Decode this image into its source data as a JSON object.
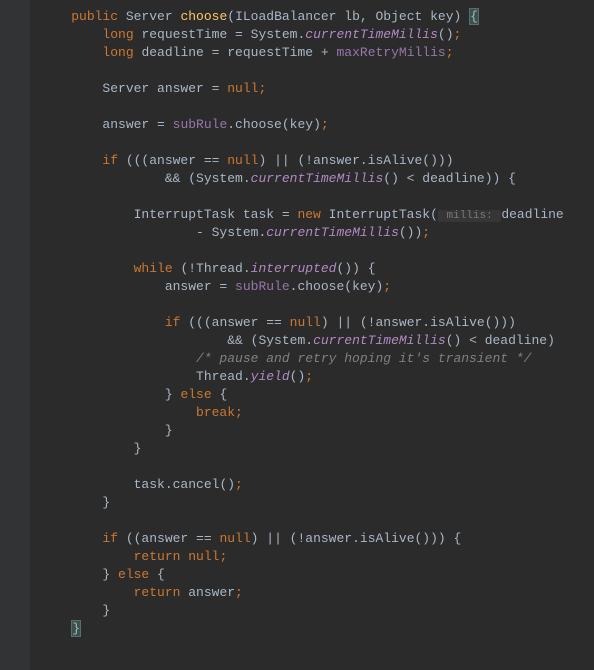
{
  "code": {
    "lines": [
      {
        "indent": 1,
        "segments": [
          {
            "t": "public ",
            "c": "kw"
          },
          {
            "t": "Server ",
            "c": "type"
          },
          {
            "t": "choose",
            "c": "method-decl"
          },
          {
            "t": "(",
            "c": "paren"
          },
          {
            "t": "ILoadBalancer ",
            "c": "type"
          },
          {
            "t": "lb",
            "c": "param"
          },
          {
            "t": ", ",
            "c": "op"
          },
          {
            "t": "Object ",
            "c": "type"
          },
          {
            "t": "key",
            "c": "param"
          },
          {
            "t": ") ",
            "c": "paren"
          },
          {
            "t": "{",
            "c": "brace-match"
          }
        ]
      },
      {
        "indent": 2,
        "segments": [
          {
            "t": "long ",
            "c": "kw"
          },
          {
            "t": "requestTime = System.",
            "c": "type"
          },
          {
            "t": "currentTimeMillis",
            "c": "method-static"
          },
          {
            "t": "()",
            "c": "paren"
          },
          {
            "t": ";",
            "c": "semicolon"
          }
        ]
      },
      {
        "indent": 2,
        "segments": [
          {
            "t": "long ",
            "c": "kw"
          },
          {
            "t": "deadline = requestTime + ",
            "c": "type"
          },
          {
            "t": "maxRetryMillis",
            "c": "field"
          },
          {
            "t": ";",
            "c": "semicolon"
          }
        ]
      },
      {
        "indent": 0,
        "segments": []
      },
      {
        "indent": 2,
        "segments": [
          {
            "t": "Server answer = ",
            "c": "type"
          },
          {
            "t": "null",
            "c": "kw"
          },
          {
            "t": ";",
            "c": "semicolon"
          }
        ]
      },
      {
        "indent": 0,
        "segments": []
      },
      {
        "indent": 2,
        "segments": [
          {
            "t": "answer = ",
            "c": "type"
          },
          {
            "t": "subRule",
            "c": "field"
          },
          {
            "t": ".choose(key)",
            "c": "type"
          },
          {
            "t": ";",
            "c": "semicolon"
          }
        ]
      },
      {
        "indent": 0,
        "segments": []
      },
      {
        "indent": 2,
        "segments": [
          {
            "t": "if ",
            "c": "kw"
          },
          {
            "t": "(((answer == ",
            "c": "type"
          },
          {
            "t": "null",
            "c": "kw"
          },
          {
            "t": ") || (!answer.isAlive()))",
            "c": "type"
          }
        ]
      },
      {
        "indent": 4,
        "segments": [
          {
            "t": "&& (System.",
            "c": "type"
          },
          {
            "t": "currentTimeMillis",
            "c": "method-static"
          },
          {
            "t": "() < deadline)) {",
            "c": "type"
          }
        ]
      },
      {
        "indent": 0,
        "segments": []
      },
      {
        "indent": 3,
        "segments": [
          {
            "t": "InterruptTask task = ",
            "c": "type"
          },
          {
            "t": "new ",
            "c": "kw"
          },
          {
            "t": "InterruptTask(",
            "c": "type"
          },
          {
            "t": " millis: ",
            "c": "hint"
          },
          {
            "t": "deadline",
            "c": "type"
          }
        ]
      },
      {
        "indent": 5,
        "segments": [
          {
            "t": "- System.",
            "c": "type"
          },
          {
            "t": "currentTimeMillis",
            "c": "method-static"
          },
          {
            "t": "())",
            "c": "type"
          },
          {
            "t": ";",
            "c": "semicolon"
          }
        ]
      },
      {
        "indent": 0,
        "segments": []
      },
      {
        "indent": 3,
        "segments": [
          {
            "t": "while ",
            "c": "kw"
          },
          {
            "t": "(!Thread.",
            "c": "type"
          },
          {
            "t": "interrupted",
            "c": "method-static"
          },
          {
            "t": "()) {",
            "c": "type"
          }
        ]
      },
      {
        "indent": 4,
        "segments": [
          {
            "t": "answer = ",
            "c": "type"
          },
          {
            "t": "subRule",
            "c": "field"
          },
          {
            "t": ".choose(key)",
            "c": "type"
          },
          {
            "t": ";",
            "c": "semicolon"
          }
        ]
      },
      {
        "indent": 0,
        "segments": []
      },
      {
        "indent": 4,
        "segments": [
          {
            "t": "if ",
            "c": "kw"
          },
          {
            "t": "(((answer == ",
            "c": "type"
          },
          {
            "t": "null",
            "c": "kw"
          },
          {
            "t": ") || (!answer.isAlive()))",
            "c": "type"
          }
        ]
      },
      {
        "indent": 6,
        "segments": [
          {
            "t": "&& (System.",
            "c": "type"
          },
          {
            "t": "currentTimeMillis",
            "c": "method-static"
          },
          {
            "t": "() < deadline)",
            "c": "type"
          }
        ]
      },
      {
        "indent": 5,
        "segments": [
          {
            "t": "/* pause and retry hoping it's transient */",
            "c": "comment"
          }
        ]
      },
      {
        "indent": 5,
        "segments": [
          {
            "t": "Thread.",
            "c": "type"
          },
          {
            "t": "yield",
            "c": "method-static"
          },
          {
            "t": "()",
            "c": "type"
          },
          {
            "t": ";",
            "c": "semicolon"
          }
        ]
      },
      {
        "indent": 4,
        "segments": [
          {
            "t": "} ",
            "c": "type"
          },
          {
            "t": "else ",
            "c": "kw"
          },
          {
            "t": "{",
            "c": "type"
          }
        ]
      },
      {
        "indent": 5,
        "segments": [
          {
            "t": "break",
            "c": "kw"
          },
          {
            "t": ";",
            "c": "semicolon"
          }
        ]
      },
      {
        "indent": 4,
        "segments": [
          {
            "t": "}",
            "c": "type"
          }
        ]
      },
      {
        "indent": 3,
        "segments": [
          {
            "t": "}",
            "c": "type"
          }
        ]
      },
      {
        "indent": 0,
        "segments": []
      },
      {
        "indent": 3,
        "segments": [
          {
            "t": "task.cancel()",
            "c": "type"
          },
          {
            "t": ";",
            "c": "semicolon"
          }
        ]
      },
      {
        "indent": 2,
        "segments": [
          {
            "t": "}",
            "c": "type"
          }
        ]
      },
      {
        "indent": 0,
        "segments": []
      },
      {
        "indent": 2,
        "segments": [
          {
            "t": "if ",
            "c": "kw"
          },
          {
            "t": "((answer == ",
            "c": "type"
          },
          {
            "t": "null",
            "c": "kw"
          },
          {
            "t": ") || (!answer.isAlive())) {",
            "c": "type"
          }
        ]
      },
      {
        "indent": 3,
        "segments": [
          {
            "t": "return null",
            "c": "kw"
          },
          {
            "t": ";",
            "c": "semicolon"
          }
        ]
      },
      {
        "indent": 2,
        "segments": [
          {
            "t": "} ",
            "c": "type"
          },
          {
            "t": "else ",
            "c": "kw"
          },
          {
            "t": "{",
            "c": "type"
          }
        ]
      },
      {
        "indent": 3,
        "segments": [
          {
            "t": "return ",
            "c": "kw"
          },
          {
            "t": "answer",
            "c": "type"
          },
          {
            "t": ";",
            "c": "semicolon"
          }
        ]
      },
      {
        "indent": 2,
        "segments": [
          {
            "t": "}",
            "c": "type"
          }
        ]
      },
      {
        "indent": 1,
        "segments": [
          {
            "t": "}",
            "c": "brace-match"
          }
        ]
      }
    ]
  },
  "gutter_icon": "collapse-icon"
}
